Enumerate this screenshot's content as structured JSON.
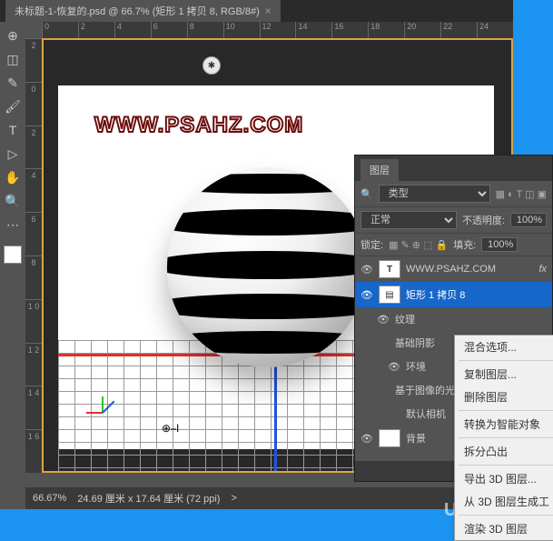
{
  "tab": {
    "title": "未标题-1-恢复的.psd @ 66.7% (矩形 1 拷贝 8, RGB/8#)",
    "close": "×"
  },
  "ruler": {
    "h": [
      "0",
      "2",
      "4",
      "6",
      "8",
      "10",
      "12",
      "14",
      "16",
      "18",
      "20",
      "22",
      "24"
    ],
    "v": [
      "2",
      "0",
      "2",
      "4",
      "6",
      "8",
      "1\n0",
      "1\n2",
      "1\n4",
      "1\n6"
    ]
  },
  "status": {
    "zoom": "66.67%",
    "info": "24.69 厘米 x 17.64 厘米 (72 ppi)",
    "arrow": ">"
  },
  "watermark": "WWW.PSAHZ.COM",
  "site": "UiBQ.Com",
  "marker": "✱",
  "layers": {
    "tab": "图层",
    "filter_icon": "🔍",
    "filter_label": "类型",
    "blend": "正常",
    "opacity_label": "不透明度:",
    "opacity_val": "100%",
    "lock_label": "锁定:",
    "fill_label": "填充:",
    "fill_val": "100%",
    "footer_fx": "fx",
    "items": [
      {
        "eye": "👁",
        "type": "T",
        "name": "WWW.PSAHZ.COM",
        "fx": "fx"
      },
      {
        "eye": "👁",
        "type": "shape",
        "name": "矩形 1 拷贝 8",
        "sel": true
      },
      {
        "eye": "👁",
        "type": "group",
        "name": "纹理"
      },
      {
        "eye": "",
        "type": "group",
        "name": "基础阴影"
      },
      {
        "eye": "👁",
        "type": "group",
        "name": "环境"
      },
      {
        "eye": "",
        "type": "group",
        "name": "基于图像的光照"
      },
      {
        "eye": "",
        "type": "group",
        "name": "默认相机"
      },
      {
        "eye": "👁",
        "type": "bg",
        "name": "背景"
      }
    ]
  },
  "context": {
    "items": [
      "混合选项...",
      "复制图层...",
      "删除图层",
      "转换为智能对象",
      "拆分凸出",
      "导出 3D 图层...",
      "从 3D 图层生成工",
      "渲染 3D 图层"
    ],
    "seps": [
      0,
      2,
      3,
      4
    ]
  }
}
